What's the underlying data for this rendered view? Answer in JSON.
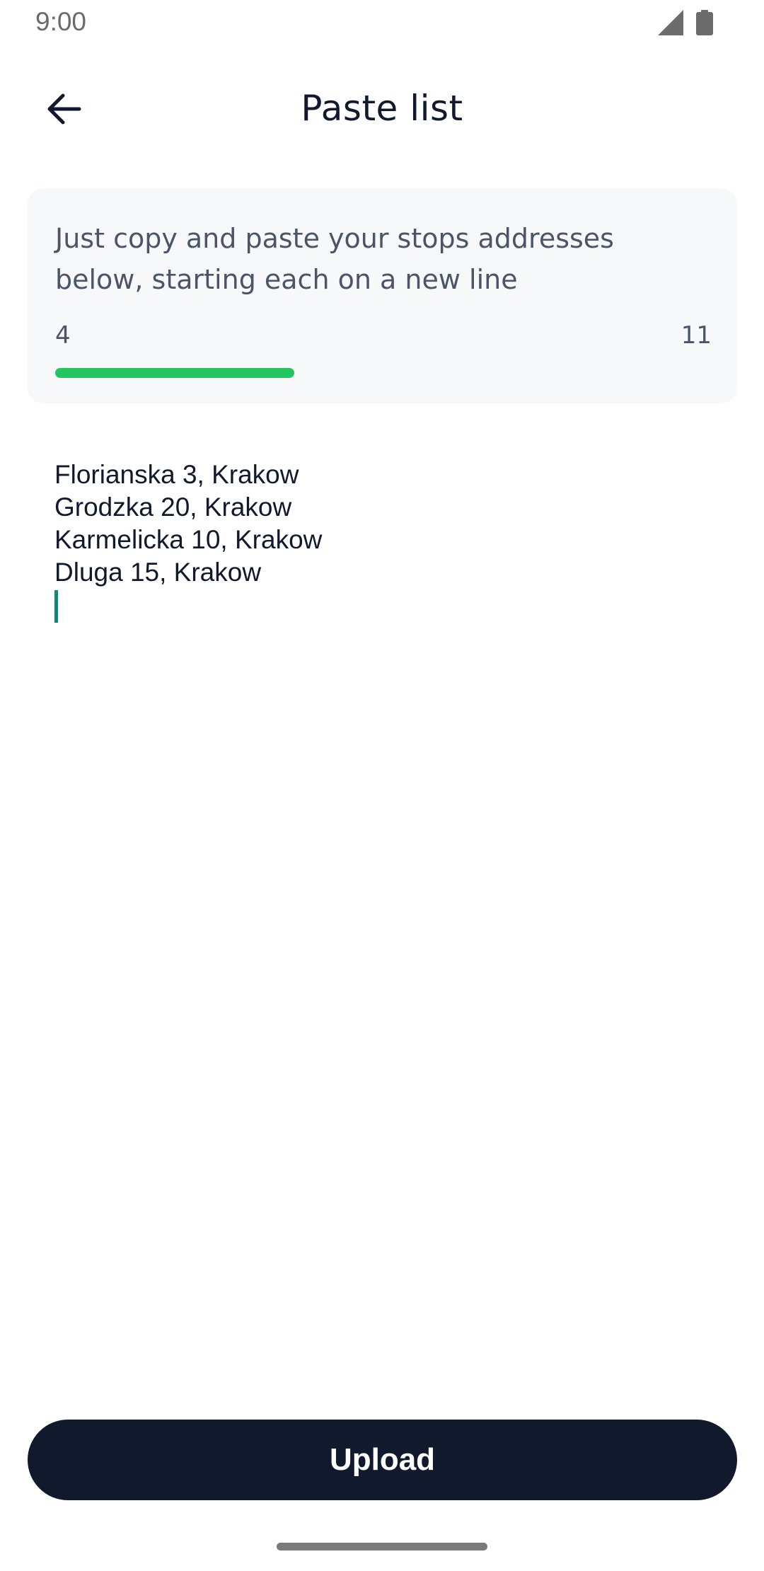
{
  "status_bar": {
    "time": "9:00",
    "icons": [
      "cellular-signal-icon",
      "battery-icon"
    ]
  },
  "header": {
    "back_icon": "arrow-left-icon",
    "title": "Paste list"
  },
  "info_card": {
    "instructions": "Just copy and paste your stops addresses below, starting each on a new line",
    "count_current": "4",
    "count_max": "11",
    "progress_fraction": 0.364
  },
  "address_input": {
    "lines": [
      "Florianska 3, Krakow",
      "Grodzka 20, Krakow",
      "Karmelicka 10, Krakow",
      "Dluga 15, Krakow"
    ]
  },
  "footer": {
    "upload_label": "Upload"
  },
  "colors": {
    "accent_progress": "#22c55e",
    "primary_dark": "#111a2c",
    "cursor": "#0f8a6e",
    "card_background": "#f7f8fa"
  }
}
